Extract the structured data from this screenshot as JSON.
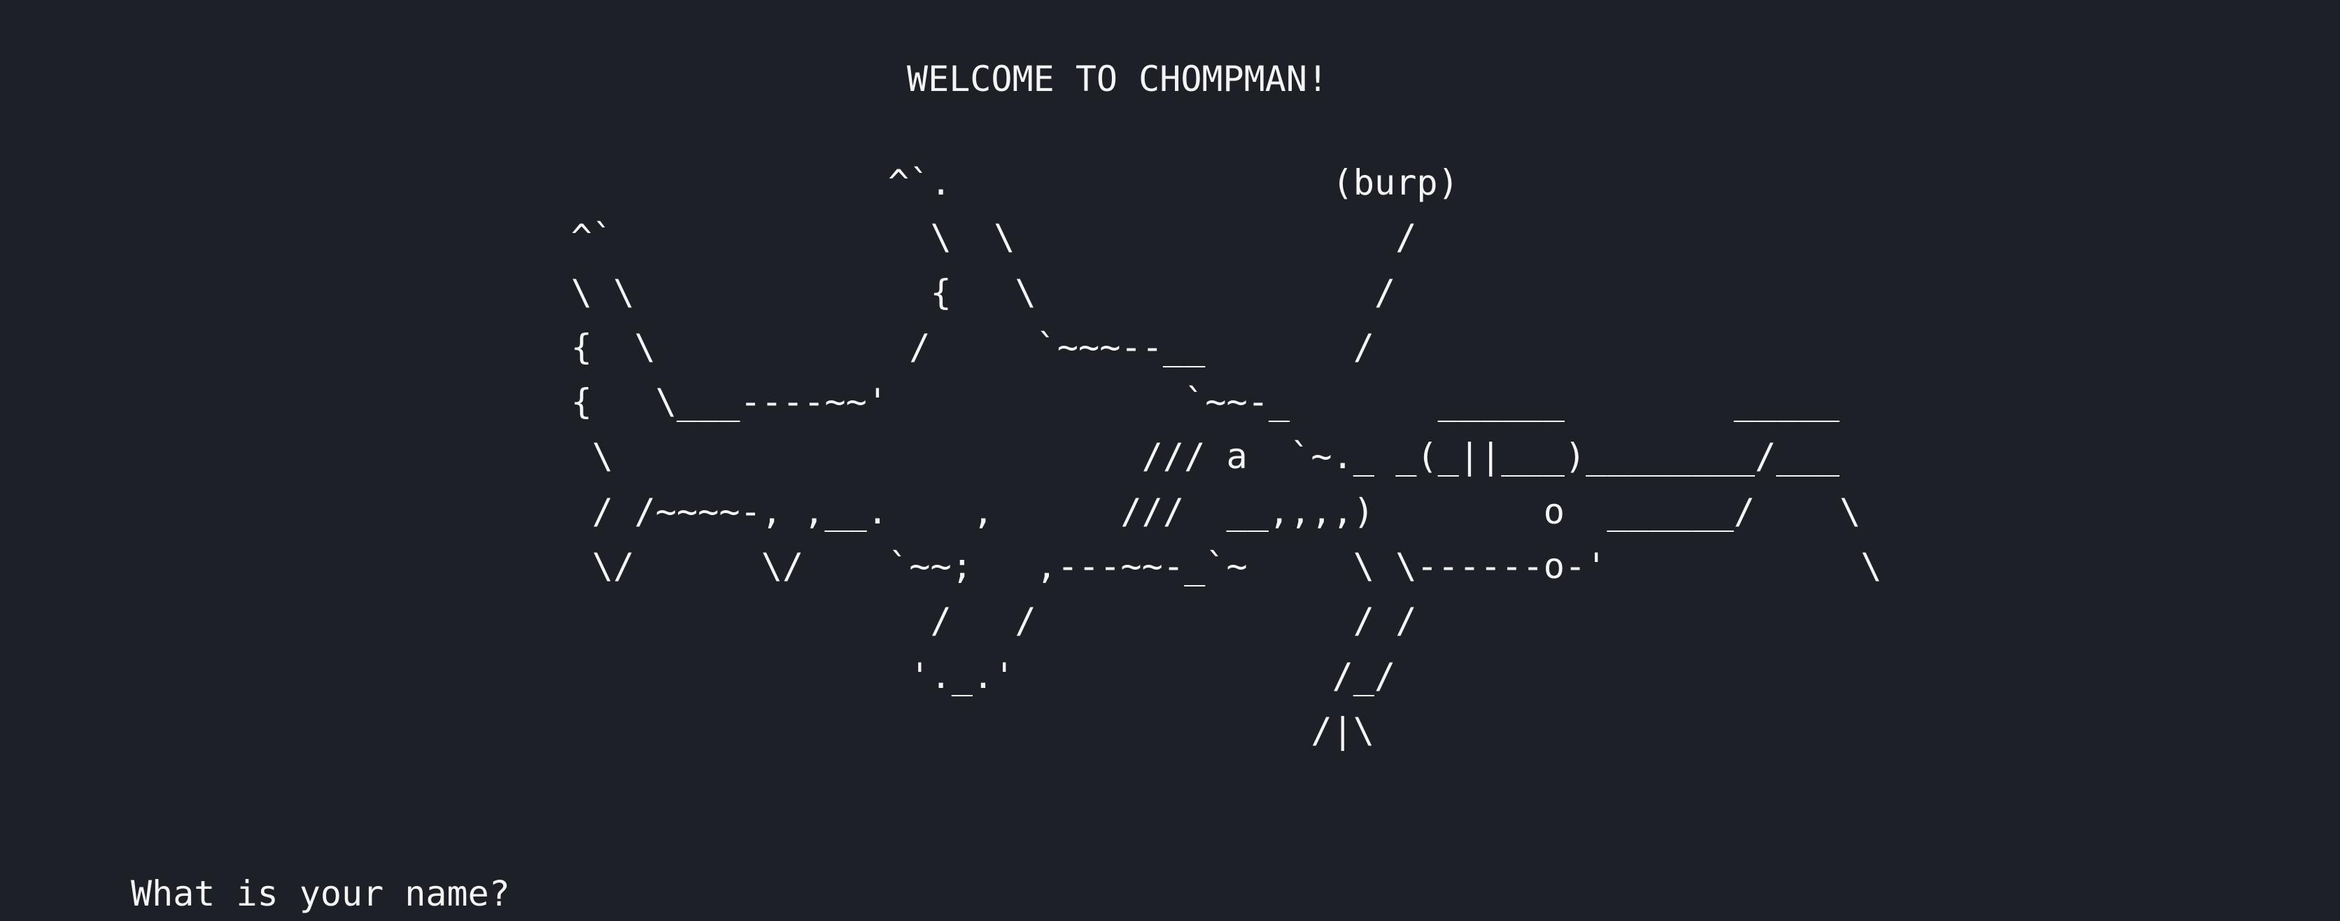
{
  "terminal": {
    "banner": "WELCOME TO CHOMPMAN!",
    "ascii_art": "                                          ^`.                  (burp)\n                           ^`               \\  \\                  /\n                           \\ \\              {   \\                /\n                           {  \\            /     `~~~--__       /\n                           {   \\___----~~'              `~~-_       ______        _____\n                            \\                         /// a  `~._ _(_||___)________/___\n                            / /~~~~-, ,__.    ,      ///  __,,,,)        o  ______/    \\\n                            \\/      \\/    `~~;   ,---~~-_`~     \\ \\------o-'            \\\n                                            /   /               / /\n                                           '._.'               /_/\n                                                              /|\\",
    "prompt_text": "What is your name?"
  }
}
